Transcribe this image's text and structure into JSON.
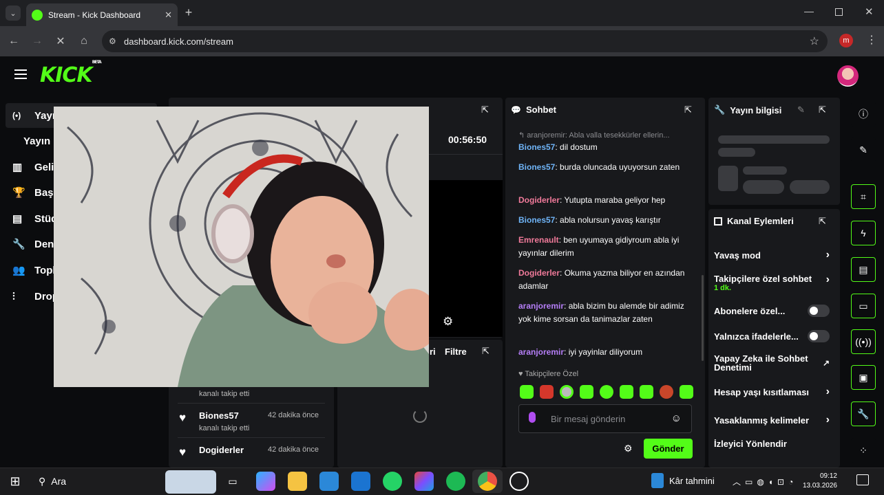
{
  "browser": {
    "tab_title": "Stream - Kick Dashboard",
    "url": "dashboard.kick.com/stream",
    "profile_initial": "m"
  },
  "app": {
    "logo": "KICK",
    "logo_badge": "BETA"
  },
  "sidebar": {
    "items": [
      {
        "label": "Yayın",
        "icon": "broadcast-icon"
      },
      {
        "label": "Yayın",
        "icon": ""
      },
      {
        "label": "Geli",
        "icon": "chart-icon"
      },
      {
        "label": "Başa",
        "icon": "trophy-icon"
      },
      {
        "label": "Stüd",
        "icon": "studio-icon"
      },
      {
        "label": "Den",
        "icon": "wrench-icon"
      },
      {
        "label": "Topl",
        "icon": "community-icon"
      },
      {
        "label": "Drop",
        "icon": "drops-icon"
      }
    ]
  },
  "stream_panel": {
    "timer": "00:56:50"
  },
  "followers_panel": {
    "filter_label_partial": "ri",
    "filter_label": "Filtre",
    "rows": [
      {
        "name": "",
        "sub": "kanalı takip etti",
        "time": ""
      },
      {
        "name": "Biones57",
        "sub": "kanalı takip etti",
        "time": "42 dakika önce"
      },
      {
        "name": "Dogiderler",
        "sub": "kanalı takip etti",
        "time": "42 dakika önce"
      }
    ]
  },
  "chat": {
    "title": "Sohbet",
    "reply_preview": "aranjoremir: Abla valla tesekkürler ellerin...",
    "messages": [
      {
        "user": "Biones57",
        "text": "dil dostum",
        "color": "blue"
      },
      {
        "user": "Biones57",
        "text": "burda oluncada uyuyorsun zaten",
        "color": "blue"
      },
      {
        "user": "Dogiderler",
        "text": "Yutupta maraba geliyor hep",
        "color": "pink"
      },
      {
        "user": "Biones57",
        "text": "abla nolursun yavaş karıştır",
        "color": "blue"
      },
      {
        "user": "Emrenault",
        "text": "ben uyumaya gidiyroum abla iyi yayınlar dilerim",
        "color": "pink"
      },
      {
        "user": "Dogiderler",
        "text": "Okuma yazma biliyor en azından adamlar",
        "color": "pink"
      },
      {
        "user": "aranjoremir",
        "text": "abla bizim bu alemde bir adimiz yok kime sorsan da tanimazlar zaten",
        "color": "purple"
      },
      {
        "user": "aranjoremir",
        "text": "iyi yayinlar diliyorum",
        "color": "purple"
      }
    ],
    "followers_only": "Takipçilere Özel",
    "input_placeholder": "Bir mesaj gönderin",
    "send_label": "Gönder"
  },
  "stream_info": {
    "title": "Yayın bilgisi"
  },
  "channel_actions": {
    "title": "Kanal Eylemleri",
    "items": [
      {
        "label": "Yavaş mod",
        "control": "chevron"
      },
      {
        "label": "Takipçilere özel sohbet",
        "sub": "1 dk.",
        "control": "chevron"
      },
      {
        "label": "Abonelere özel...",
        "control": "toggle"
      },
      {
        "label": "Yalnızca ifadelerle...",
        "control": "toggle"
      },
      {
        "label": "Yapay Zeka ile Sohbet Denetimi",
        "control": "external"
      },
      {
        "label": "Hesap yaşı kısıtlaması",
        "control": "chevron"
      },
      {
        "label": "Yasaklanmış kelimeler",
        "control": "chevron"
      },
      {
        "label": "İzleyici Yönlendir",
        "control": "none"
      }
    ]
  },
  "taskbar": {
    "search_label": "Ara",
    "widget_label": "Kâr tahmini",
    "time": "09:12",
    "date": "13.03.2026"
  },
  "colors": {
    "accent": "#53fc18",
    "panel": "#18191c",
    "bg": "#0b0c0e"
  }
}
